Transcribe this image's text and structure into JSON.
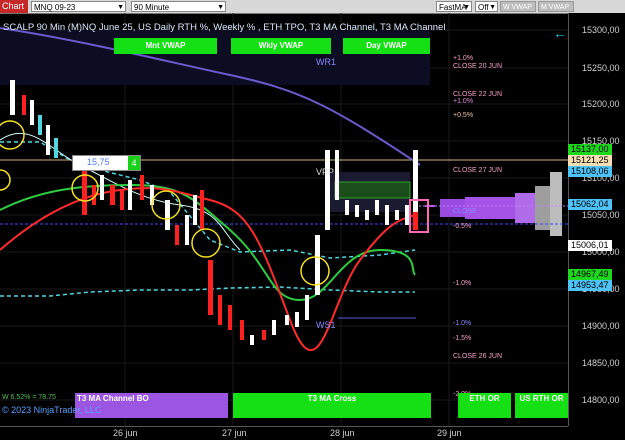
{
  "toolbar": {
    "chart_tab": "Chart",
    "instrument": "MNQ 09-23",
    "period": "90 Minute",
    "indicator_dd": "FastMA",
    "toggle": "Off",
    "w_vwap": "W VWAP",
    "m_vwap": "M VWAP"
  },
  "title": "SCALP 90 Min (M)NQ June 25, US Daily RTH %, Weekly % , ETH TPO, T3 MA Channel, T3 MA Channel",
  "vwap_buttons": {
    "mnt": "Mnt VWAP",
    "wkly": "Wkly VWAP",
    "day": "Day VWAP"
  },
  "bottom_buttons": {
    "t3_bo": "T3 MA Channel BO",
    "t3_cross": "T3 MA Cross",
    "eth_or": "ETH OR",
    "us_rth_or": "US RTH OR"
  },
  "info_box": {
    "value": "15,75",
    "count": "4"
  },
  "footer": {
    "copyright": "© 2023 NinjaTrader, LLC",
    "stat": "W 6.52% = 78.75"
  },
  "levels": [
    {
      "text": "+1.0%",
      "color": "#f6a0c8"
    },
    {
      "text": "CLOSE 20 JUN",
      "color": "#f6a0c8"
    },
    {
      "text": "CLOSE 22 JUN",
      "color": "#f6a0c8"
    },
    {
      "text": "+1.0%",
      "color": "#e08ad8"
    },
    {
      "text": "+0.5%",
      "color": "#f0c0a0"
    },
    {
      "text": "CLOSE 27 JUN",
      "color": "#f6a0c8"
    },
    {
      "text": "CLOSE",
      "color": "#8a8aff"
    },
    {
      "text": "-0.5%",
      "color": "#f6a0c8"
    },
    {
      "text": "-1.0%",
      "color": "#f6a0c8"
    },
    {
      "text": "-1.0%",
      "color": "#8a8aff"
    },
    {
      "text": "-1.5%",
      "color": "#f6a0c8"
    },
    {
      "text": "CLOSE 26 JUN",
      "color": "#f6a0c8"
    },
    {
      "text": "-2.0%",
      "color": "#f6a0c8"
    }
  ],
  "pivots": {
    "wr1": "WR1",
    "ws1": "WS1",
    "vpp": "VPP"
  },
  "y_axis": [
    "15300,00",
    "15250,00",
    "15200,00",
    "15150,00",
    "15100,00",
    "15050,00",
    "15000,00",
    "14950,00",
    "14900,00",
    "14850,00",
    "14800,00"
  ],
  "price_tags": [
    {
      "text": "15137,00",
      "bg": "#1ed61e",
      "fg": "#000"
    },
    {
      "text": "15121,25",
      "bg": "#f5deb3",
      "fg": "#000"
    },
    {
      "text": "15108,06",
      "bg": "#4fc3f7",
      "fg": "#000"
    },
    {
      "text": "15062,04",
      "bg": "#4fc3f7",
      "fg": "#000"
    },
    {
      "text": "15006,01",
      "bg": "#ffffff",
      "fg": "#000"
    },
    {
      "text": "14967,49",
      "bg": "#1ed61e",
      "fg": "#000"
    },
    {
      "text": "14953,47",
      "bg": "#4fc3f7",
      "fg": "#000"
    }
  ],
  "x_axis": [
    "26 jun",
    "27 jun",
    "28 jun",
    "29 jun"
  ]
}
